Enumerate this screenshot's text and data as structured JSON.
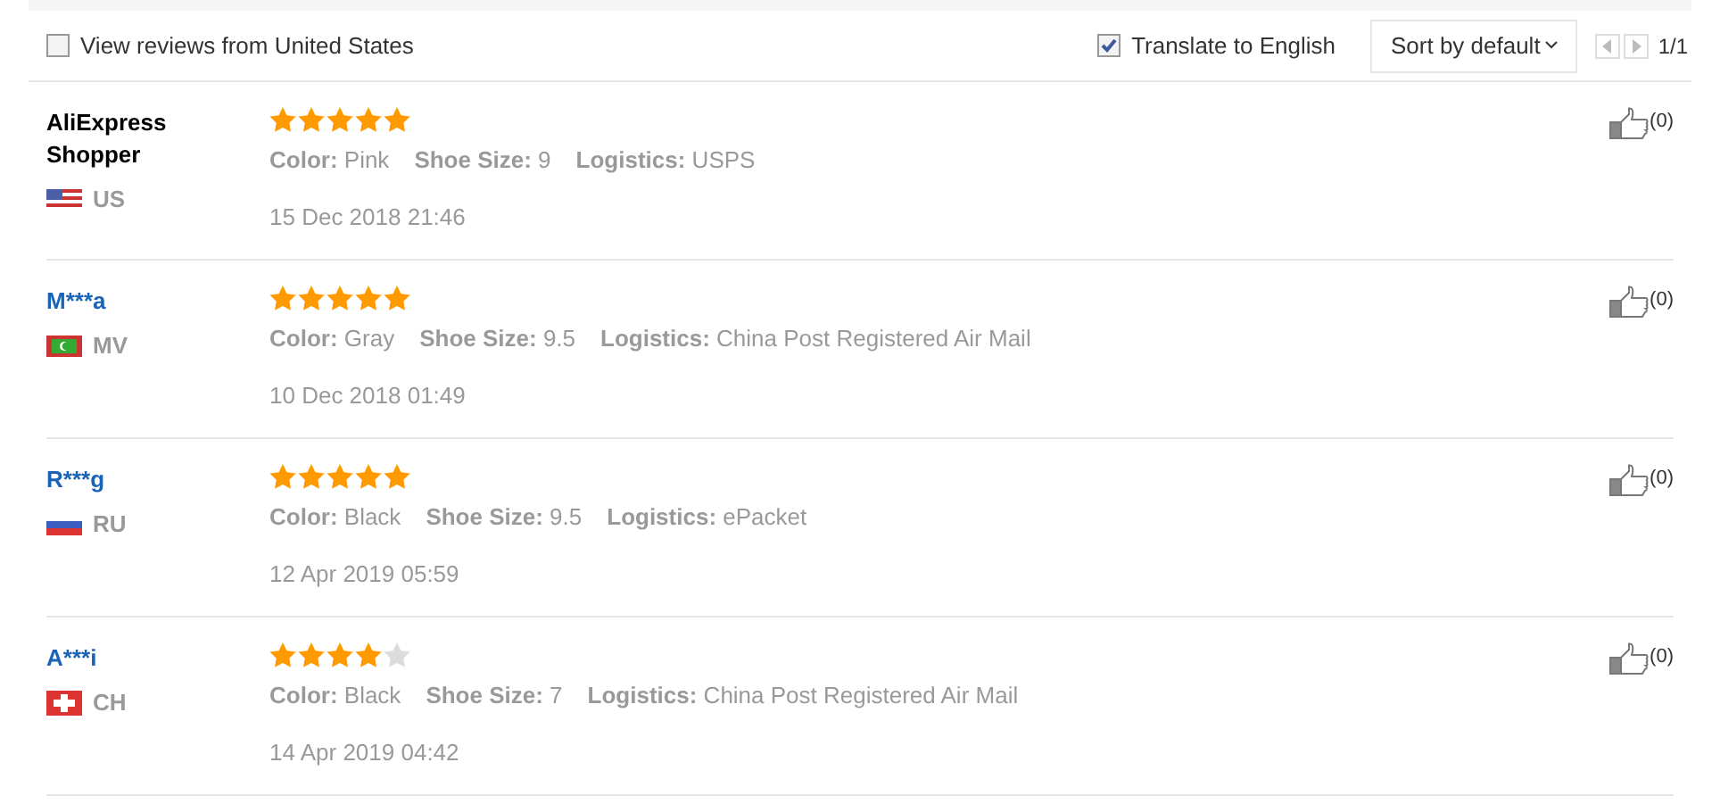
{
  "filters": {
    "country_filter": {
      "label": "View reviews from United States",
      "checked": false
    },
    "translate": {
      "label": "Translate to English",
      "checked": true
    },
    "sort": {
      "label": "Sort by default"
    },
    "pager": {
      "page": "1/1"
    }
  },
  "reviews": [
    {
      "name": "AliExpress Shopper",
      "linked": false,
      "flag": {
        "kind": "stripes"
      },
      "country": "US",
      "stars": 5,
      "details": [
        {
          "label": "Color:",
          "value": "Pink"
        },
        {
          "label": "Shoe Size:",
          "value": "9"
        },
        {
          "label": "Logistics:",
          "value": "USPS"
        }
      ],
      "date": "15 Dec 2018 21:46",
      "likes": "(0)"
    },
    {
      "name": "M***a",
      "linked": true,
      "flag": {
        "kind": "crescent"
      },
      "country": "MV",
      "stars": 5,
      "details": [
        {
          "label": "Color:",
          "value": "Gray"
        },
        {
          "label": "Shoe Size:",
          "value": "9.5"
        },
        {
          "label": "Logistics:",
          "value": "China Post Registered Air Mail"
        }
      ],
      "date": "10 Dec 2018 01:49",
      "likes": "(0)"
    },
    {
      "name": "R***g",
      "linked": true,
      "flag": {
        "kind": "tricolor"
      },
      "country": "RU",
      "stars": 5,
      "details": [
        {
          "label": "Color:",
          "value": "Black"
        },
        {
          "label": "Shoe Size:",
          "value": "9.5"
        },
        {
          "label": "Logistics:",
          "value": "ePacket"
        }
      ],
      "date": "12 Apr 2019 05:59",
      "likes": "(0)"
    },
    {
      "name": "A***i",
      "linked": true,
      "flag": {
        "kind": "cross"
      },
      "country": "CH",
      "stars": 4,
      "details": [
        {
          "label": "Color:",
          "value": "Black"
        },
        {
          "label": "Shoe Size:",
          "value": "7"
        },
        {
          "label": "Logistics:",
          "value": "China Post Registered Air Mail"
        }
      ],
      "date": "14 Apr 2019 04:42",
      "likes": "(0)"
    }
  ]
}
